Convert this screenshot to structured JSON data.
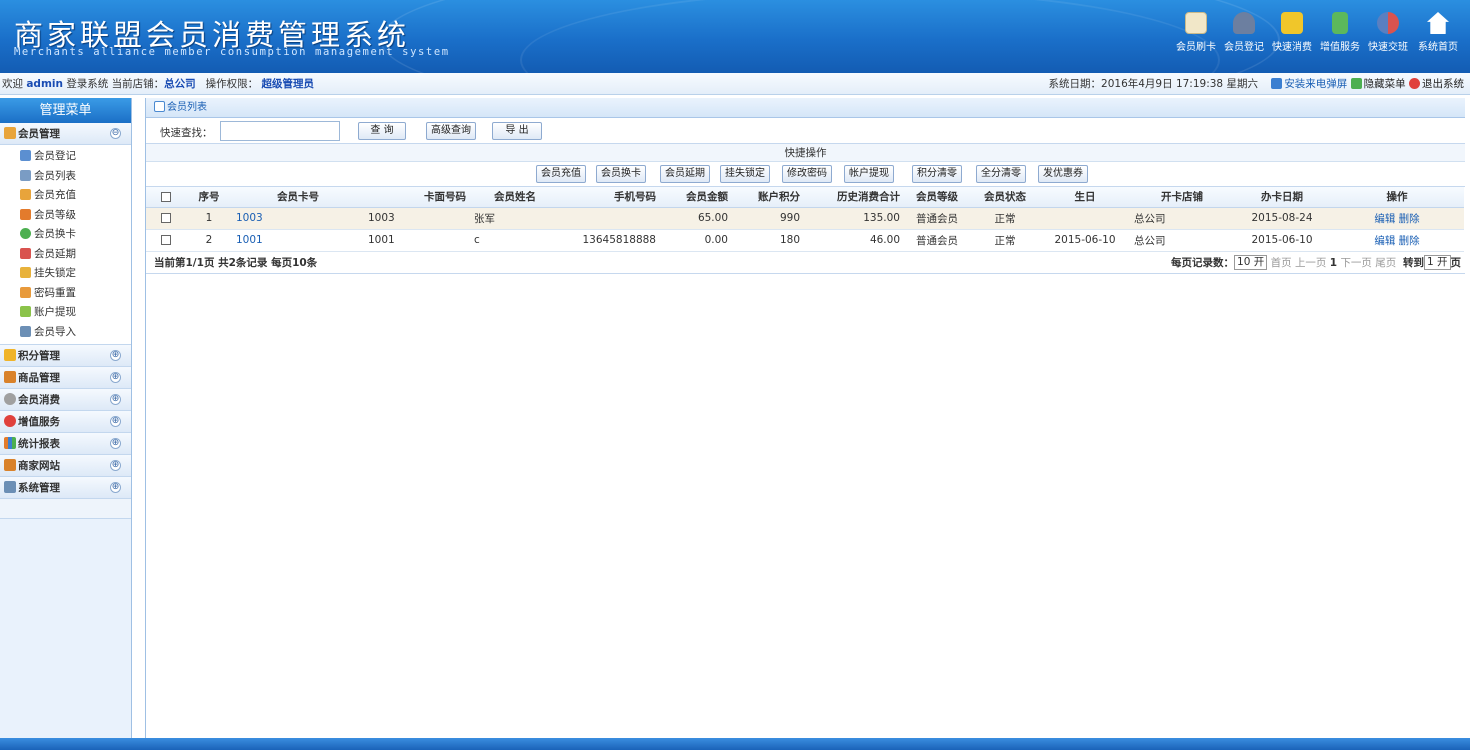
{
  "header": {
    "title": "商家联盟会员消费管理系统",
    "subtitle": "Merchants alliance member consumption management system",
    "nav": [
      {
        "label": "会员刷卡",
        "icon": "card-icon",
        "color": "#f1e7c8"
      },
      {
        "label": "会员登记",
        "icon": "user-icon",
        "color": "#6c7fa0"
      },
      {
        "label": "快速消费",
        "icon": "cart-icon",
        "color": "#f0c62a"
      },
      {
        "label": "增值服务",
        "icon": "book-icon",
        "color": "#5cb85c"
      },
      {
        "label": "快速交班",
        "icon": "handover-icon",
        "color": "#d9534f"
      },
      {
        "label": "系统首页",
        "icon": "home-icon",
        "color": "#ffffff"
      }
    ]
  },
  "infobar": {
    "welcome": "欢迎",
    "user": "admin",
    "login_text": "登录系统 当前店铺：",
    "store": "总公司",
    "perm_label": "操作权限：",
    "perm": "超级管理员",
    "date_label": "系统日期：",
    "date": "2016年4月9日 17:19:38 星期六",
    "install": "安装来电弹屏",
    "hide_menu": "隐藏菜单",
    "logout": "退出系统"
  },
  "sidebar": {
    "title": "管理菜单",
    "member_section": {
      "label": "会员管理",
      "icon": "members-icon",
      "toggle": "⊖"
    },
    "member_items": [
      {
        "label": "会员登记",
        "icon": "register-icon",
        "color": "#5b8fd1"
      },
      {
        "label": "会员列表",
        "icon": "list-icon",
        "color": "#7a9cc4"
      },
      {
        "label": "会员充值",
        "icon": "recharge-icon",
        "color": "#e8a43b"
      },
      {
        "label": "会员等级",
        "icon": "level-icon",
        "color": "#e37b2c"
      },
      {
        "label": "会员换卡",
        "icon": "change-card-icon",
        "color": "#4caf50"
      },
      {
        "label": "会员延期",
        "icon": "calendar-icon",
        "color": "#d9534f"
      },
      {
        "label": "挂失锁定",
        "icon": "lock-icon",
        "color": "#e8b23b"
      },
      {
        "label": "密码重置",
        "icon": "key-icon",
        "color": "#e89a3b"
      },
      {
        "label": "账户提现",
        "icon": "withdraw-icon",
        "color": "#8bc34a"
      },
      {
        "label": "会员导入",
        "icon": "import-icon",
        "color": "#6c8fb5"
      }
    ],
    "sections": [
      {
        "label": "积分管理",
        "icon": "points-icon",
        "color": "#f0b429",
        "toggle": "⊕"
      },
      {
        "label": "商品管理",
        "icon": "goods-icon",
        "color": "#d9822b",
        "toggle": "⊕"
      },
      {
        "label": "会员消费",
        "icon": "consume-icon",
        "color": "#a0a0a0",
        "toggle": "⊕"
      },
      {
        "label": "增值服务",
        "icon": "heart-icon",
        "color": "#e0413c",
        "toggle": "⊕"
      },
      {
        "label": "统计报表",
        "icon": "chart-icon",
        "color": "#3b7fd1",
        "toggle": "⊕"
      },
      {
        "label": "商家网站",
        "icon": "site-icon",
        "color": "#d9822b",
        "toggle": "⊕"
      },
      {
        "label": "系统管理",
        "icon": "tools-icon",
        "color": "#6c8fb5",
        "toggle": "⊕"
      }
    ]
  },
  "main": {
    "panel_title": "会员列表",
    "search_label": "快速查找：",
    "search_value": "",
    "btn_query": "查 询",
    "btn_advanced": "高级查询",
    "btn_export": "导 出",
    "quick_title": "快捷操作",
    "quick_buttons": [
      "会员充值",
      "会员换卡",
      "会员延期",
      "挂失锁定",
      "修改密码",
      "帐户提现",
      "积分清零",
      "全分清零",
      "发优惠券"
    ],
    "columns": [
      "序号",
      "会员卡号",
      "卡面号码",
      "会员姓名",
      "手机号码",
      "会员金额",
      "账户积分",
      "历史消费合计",
      "会员等级",
      "会员状态",
      "生日",
      "开卡店铺",
      "办卡日期",
      "操作"
    ],
    "rows": [
      {
        "no": "1",
        "card": "1003",
        "face": "1003",
        "name": "张军",
        "phone": "",
        "amount": "65.00",
        "points": "990",
        "total": "135.00",
        "level": "普通会员",
        "status": "正常",
        "birthday": "",
        "store": "总公司",
        "date": "2015-08-24",
        "edit": "编辑",
        "del": "删除"
      },
      {
        "no": "2",
        "card": "1001",
        "face": "1001",
        "name": "c",
        "phone": "13645818888",
        "amount": "0.00",
        "points": "180",
        "total": "46.00",
        "level": "普通会员",
        "status": "正常",
        "birthday": "2015-06-10",
        "store": "总公司",
        "date": "2015-06-10",
        "edit": "编辑",
        "del": "删除"
      }
    ],
    "pager": {
      "summary": "当前第1/1页 共2条记录 每页10条",
      "per_page_label": "每页记录数：",
      "per_page_value": "10",
      "open_text": "开",
      "first": "首页",
      "prev": "上一页",
      "current": "1",
      "next": "下一页",
      "last": "尾页",
      "goto_label": "转到",
      "goto_value": "1",
      "goto_open": "开",
      "goto_suffix": "页"
    }
  }
}
